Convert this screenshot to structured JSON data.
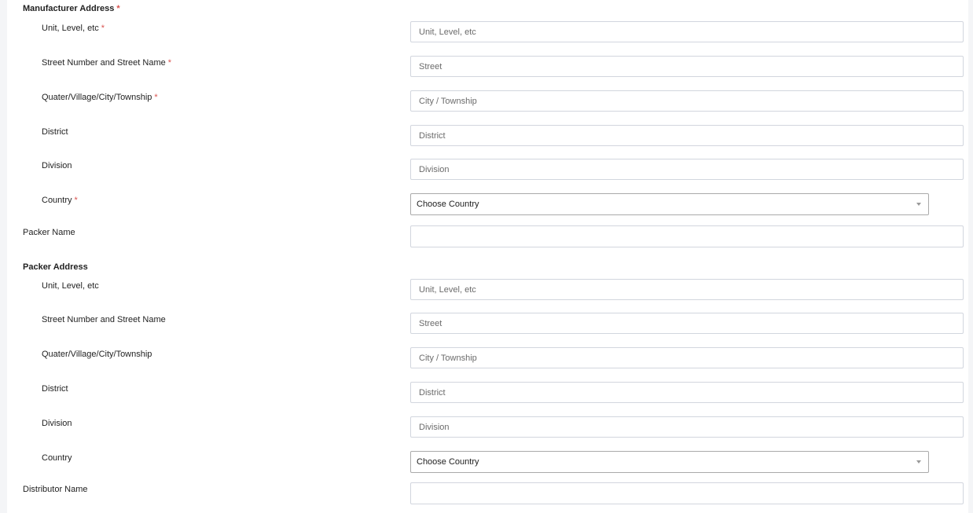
{
  "manufacturer_address": {
    "title": "Manufacturer Address",
    "required_mark": "*",
    "fields": [
      {
        "label": "Unit, Level, etc",
        "required": "*",
        "placeholder": "Unit, Level, etc",
        "value": ""
      },
      {
        "label": "Street Number and Street Name",
        "required": "*",
        "placeholder": "Street",
        "value": ""
      },
      {
        "label": "Quater/Village/City/Township",
        "required": "*",
        "placeholder": "City / Township",
        "value": ""
      },
      {
        "label": "District",
        "required": "",
        "placeholder": "District",
        "value": ""
      },
      {
        "label": "Division",
        "required": "",
        "placeholder": "Division",
        "value": ""
      }
    ],
    "country": {
      "label": "Country",
      "required": "*",
      "selected": "Choose Country"
    }
  },
  "packer_name": {
    "label": "Packer Name",
    "value": ""
  },
  "packer_address": {
    "title": "Packer Address",
    "fields": [
      {
        "label": "Unit, Level, etc",
        "placeholder": "Unit, Level, etc",
        "value": ""
      },
      {
        "label": "Street Number and Street Name",
        "placeholder": "Street",
        "value": ""
      },
      {
        "label": "Quater/Village/City/Township",
        "placeholder": "City / Township",
        "value": ""
      },
      {
        "label": "District",
        "placeholder": "District",
        "value": ""
      },
      {
        "label": "Division",
        "placeholder": "Division",
        "value": ""
      }
    ],
    "country": {
      "label": "Country",
      "selected": "Choose Country"
    }
  },
  "distributor_name": {
    "label": "Distributor Name",
    "value": ""
  },
  "colors": {
    "required": "#d9534f",
    "input_border": "#d2d6de",
    "select_border": "#aaaaaa",
    "side_panel": "#f4f5f7"
  },
  "icons": {
    "select_caret": "caret-down-icon"
  }
}
